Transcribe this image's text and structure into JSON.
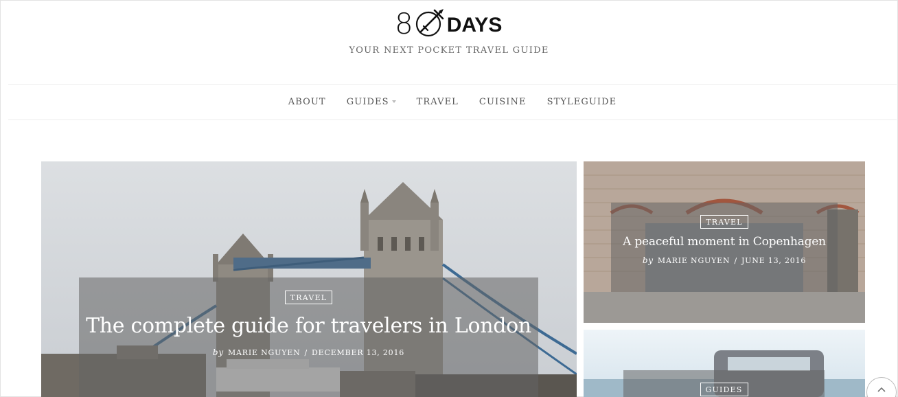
{
  "brand": {
    "logo_number": "8",
    "logo_word": "DAYS",
    "tagline": "YOUR NEXT POCKET TRAVEL GUIDE",
    "icon": "globe-plane-icon"
  },
  "nav": {
    "items": [
      {
        "label": "ABOUT",
        "has_dropdown": false
      },
      {
        "label": "GUIDES",
        "has_dropdown": true
      },
      {
        "label": "TRAVEL",
        "has_dropdown": false
      },
      {
        "label": "CUISINE",
        "has_dropdown": false
      },
      {
        "label": "STYLEGUIDE",
        "has_dropdown": false
      }
    ]
  },
  "featured": {
    "category": "TRAVEL",
    "title": "The complete guide for travelers in London",
    "by": "by",
    "author": "MARIE NGUYEN",
    "separator": "/",
    "date": "DECEMBER 13, 2016"
  },
  "side_posts": [
    {
      "category": "TRAVEL",
      "title": "A peaceful moment in Copenhagen",
      "by": "by",
      "author": "MARIE NGUYEN",
      "separator": "/",
      "date": "JUNE 13, 2016"
    },
    {
      "category": "GUIDES"
    }
  ],
  "scroll_top": {
    "icon": "chevron-up-icon"
  },
  "colors": {
    "text": "#333333",
    "nav_text": "#555555",
    "tagline": "#666666",
    "overlay": "rgba(100,100,100,0.55)",
    "border": "#ececec"
  }
}
